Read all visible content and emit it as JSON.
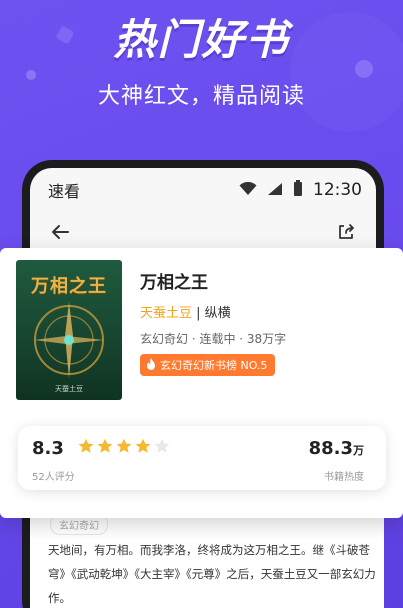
{
  "promo": {
    "title": "热门好书",
    "subtitle": "大神红文，精品阅读"
  },
  "status_bar": {
    "app_name": "速看",
    "time": "12:30"
  },
  "book": {
    "cover_title": "万相之王",
    "cover_author": "天蚕土豆",
    "title": "万相之王",
    "author": "天蚕土豆",
    "category": "纵横",
    "meta": "玄幻奇幻 · 连载中 · 38万字",
    "rank_badge": "玄幻奇幻新书榜 NO.5"
  },
  "rating": {
    "score": "8.3",
    "stars_filled": 4,
    "stars_total": 5,
    "raters": "52人评分",
    "heat_value": "88.3",
    "heat_unit": "万",
    "heat_label": "书籍热度"
  },
  "content": {
    "genre_chip": "玄幻奇幻",
    "excerpt": "天地间，有万相。而我李洛，终将成为这万相之王。继《斗破苍穹》《武动乾坤》《大主宰》《元尊》之后，天蚕土豆又一部玄幻力作。"
  },
  "colors": {
    "background": "#6a4bee",
    "author": "#f4a21a",
    "badge": "#ff7a2f",
    "star": "#f5b82e",
    "star_empty": "#e8e8e8"
  },
  "icons": [
    "back-arrow-icon",
    "share-icon",
    "wifi-icon",
    "signal-icon",
    "battery-icon",
    "fire-icon",
    "star-icon"
  ]
}
